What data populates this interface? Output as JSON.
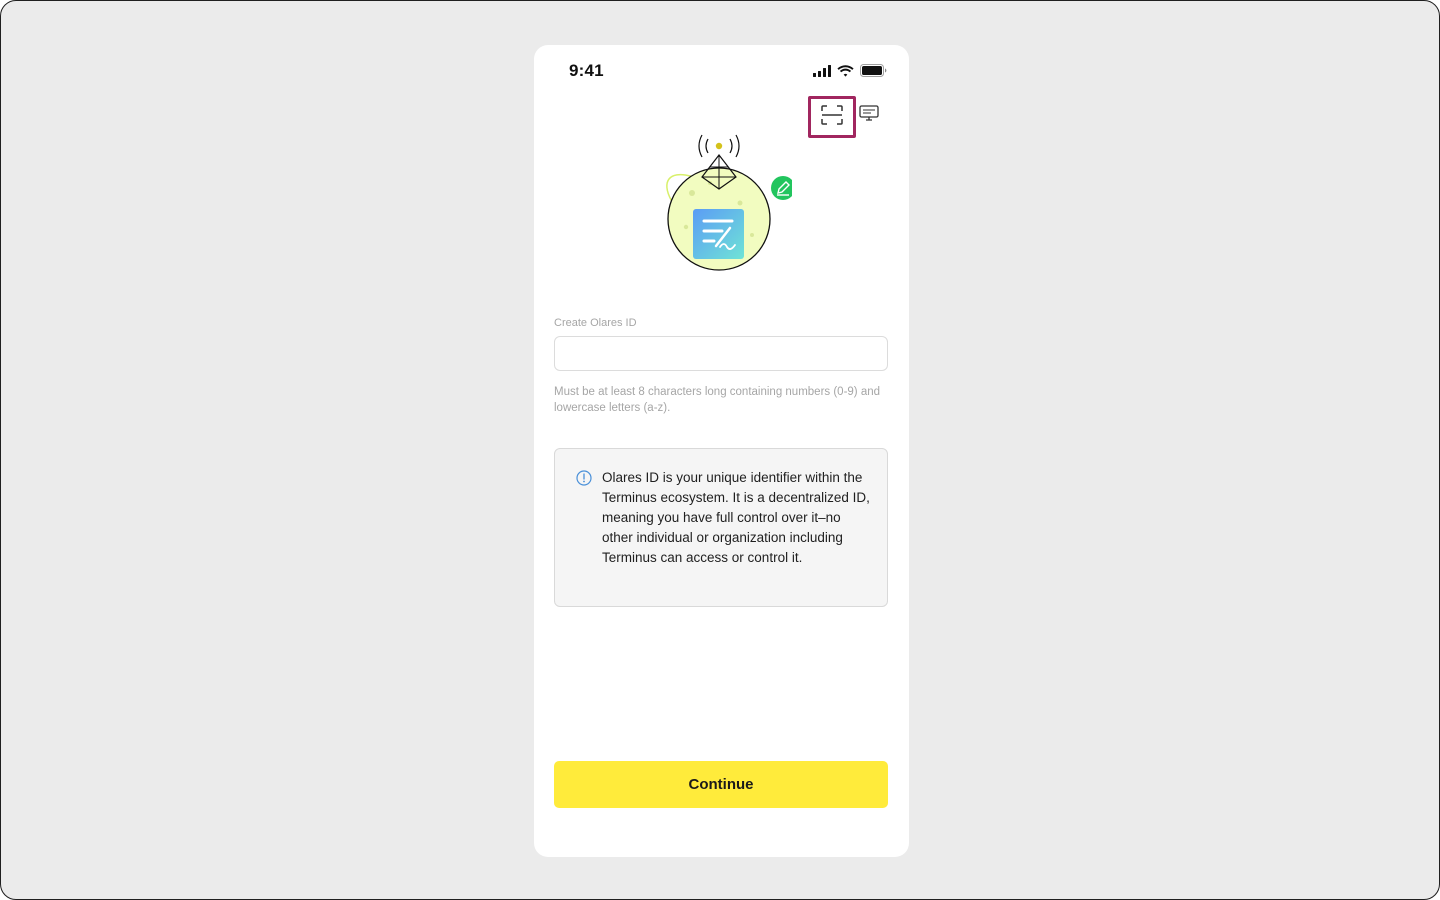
{
  "status_bar": {
    "time": "9:41",
    "icons": [
      "cellular-signal-icon",
      "wifi-icon",
      "battery-icon"
    ]
  },
  "top_actions": {
    "scan_icon": "scan-qr-icon",
    "screen_icon": "desktop-monitor-icon"
  },
  "illustration": {
    "description_icon": "globe-document-signature-illustration"
  },
  "form": {
    "label": "Create Olares ID",
    "value": "",
    "placeholder": "",
    "hint": "Must be at least 8 characters long containing numbers (0-9) and lowercase letters (a-z)."
  },
  "info": {
    "icon": "info-circle-icon",
    "text": "Olares ID  is your unique identifier within the Terminus ecosystem. It is a decentralized ID, meaning you have full control over it–no other individual or organization including Terminus can access or control it."
  },
  "actions": {
    "continue_label": "Continue"
  },
  "colors": {
    "accent_button": "#ffeb3b",
    "highlight_border": "#a1265f",
    "info_icon": "#4a90d9",
    "edit_badge": "#22c55e"
  }
}
